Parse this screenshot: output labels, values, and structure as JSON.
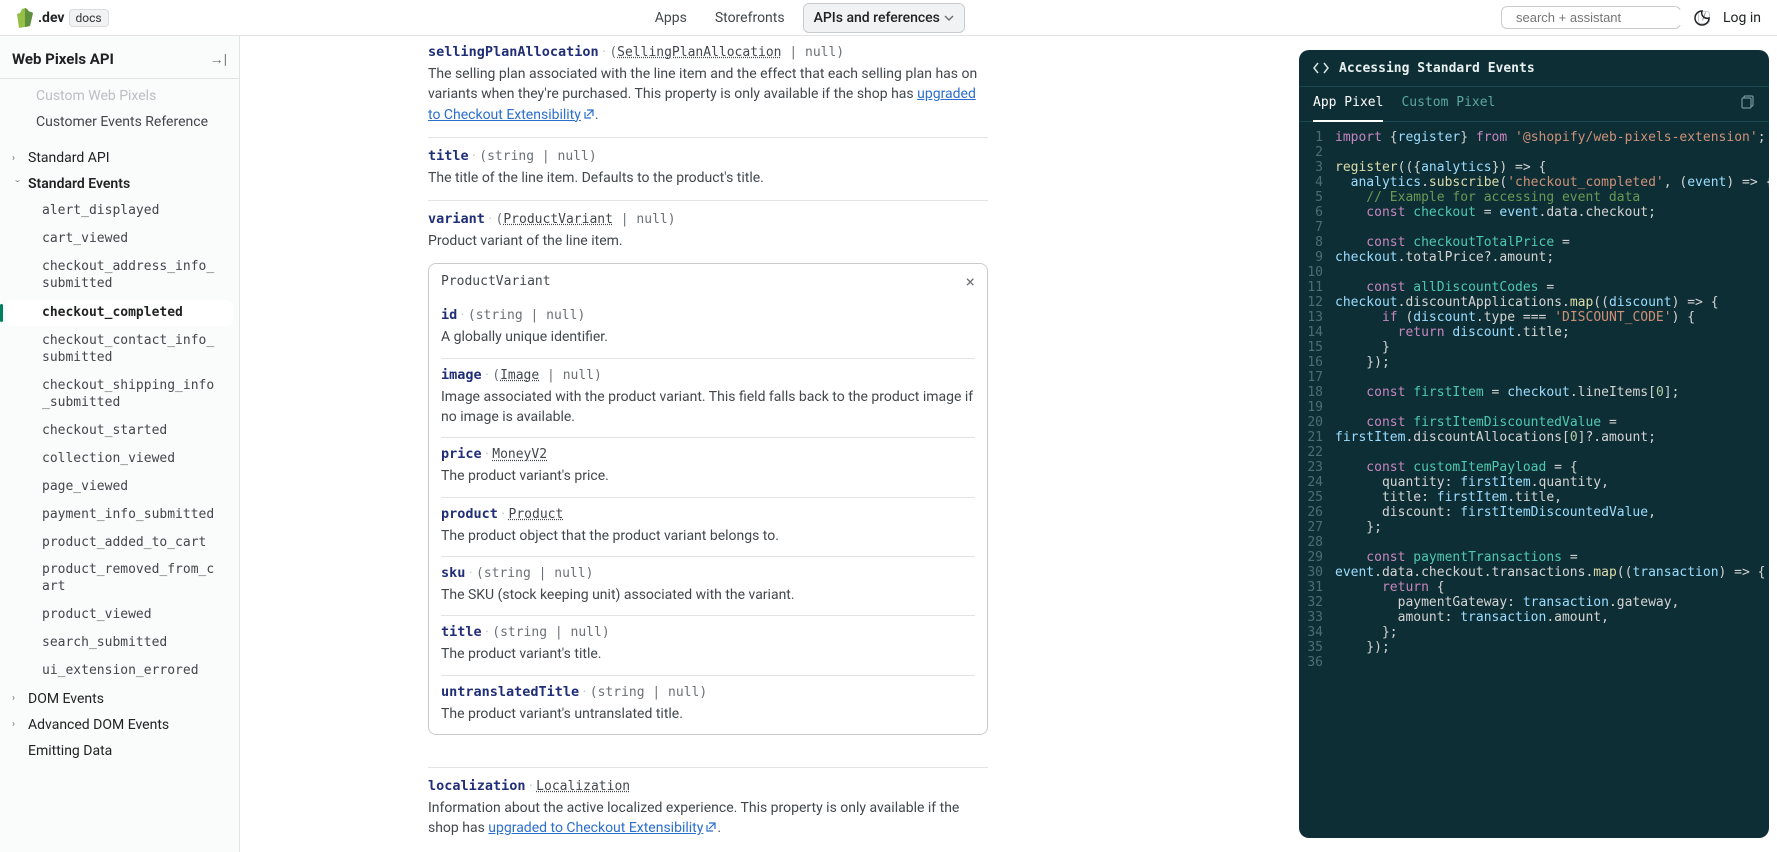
{
  "topbar": {
    "brand": ".dev",
    "docs_badge": "docs",
    "nav": [
      "Apps",
      "Storefronts",
      "APIs and references"
    ],
    "active_nav_index": 2,
    "search_placeholder": "search + assistant",
    "slash_hint": "/",
    "login": "Log in"
  },
  "sidebar": {
    "title": "Web Pixels API",
    "items_top": [
      "Custom Web Pixels",
      "Customer Events Reference"
    ],
    "standard_api": "Standard API",
    "standard_events": "Standard Events",
    "events": [
      "alert_displayed",
      "cart_viewed",
      "checkout_address_info_submitted",
      "checkout_completed",
      "checkout_contact_info_submitted",
      "checkout_shipping_info_submitted",
      "checkout_started",
      "collection_viewed",
      "page_viewed",
      "payment_info_submitted",
      "product_added_to_cart",
      "product_removed_from_cart",
      "product_viewed",
      "search_submitted",
      "ui_extension_errored"
    ],
    "active_event_index": 3,
    "dom_events": "DOM Events",
    "adv_dom_events": "Advanced DOM Events",
    "emitting_data": "Emitting Data"
  },
  "doc": {
    "props": [
      {
        "name": "sellingPlanAllocation",
        "meta_pre": "(",
        "meta_link": "SellingPlanAllocation",
        "meta_post": " | null)",
        "desc_pre": "The selling plan associated with the line item and the effect that each selling plan has on variants when they're purchased. This property is only available if the shop has ",
        "desc_link": "upgraded to Checkout Extensibility",
        "desc_post": ".",
        "external": true
      },
      {
        "name": "title",
        "meta": "(string | null)",
        "desc": "The title of the line item. Defaults to the product's title."
      },
      {
        "name": "variant",
        "meta_pre": "(",
        "meta_link": "ProductVariant",
        "meta_post": " | null)",
        "desc": "Product variant of the line item."
      }
    ],
    "nested": {
      "title": "ProductVariant",
      "props": [
        {
          "name": "id",
          "meta": "(string | null)",
          "desc": "A globally unique identifier."
        },
        {
          "name": "image",
          "meta_pre": "(",
          "meta_link": "Image",
          "meta_post": " | null)",
          "desc": "Image associated with the product variant. This field falls back to the product image if no image is available."
        },
        {
          "name": "price",
          "meta_link": "MoneyV2",
          "desc": "The product variant's price."
        },
        {
          "name": "product",
          "meta_link": "Product",
          "desc": "The product object that the product variant belongs to."
        },
        {
          "name": "sku",
          "meta": "(string | null)",
          "desc": "The SKU (stock keeping unit) associated with the variant."
        },
        {
          "name": "title",
          "meta": "(string | null)",
          "desc": "The product variant's title."
        },
        {
          "name": "untranslatedTitle",
          "meta": "(string | null)",
          "desc": "The product variant's untranslated title."
        }
      ]
    },
    "localization": {
      "name": "localization",
      "meta_link": "Localization",
      "desc_pre": "Information about the active localized experience. This property is only available if the shop has ",
      "desc_link": "upgraded to Checkout Extensibility",
      "desc_post": "."
    }
  },
  "code": {
    "title": "Accessing Standard Events",
    "tabs": [
      "App Pixel",
      "Custom Pixel"
    ],
    "active_tab": 0,
    "lines": [
      [
        {
          "t": "import ",
          "c": "c-kw"
        },
        {
          "t": "{",
          "c": "c-pn"
        },
        {
          "t": "register",
          "c": "c-var"
        },
        {
          "t": "}",
          "c": "c-pn"
        },
        {
          "t": " from ",
          "c": "c-kw"
        },
        {
          "t": "'@shopify/web-pixels-extension'",
          "c": "c-str"
        },
        {
          "t": ";",
          "c": "c-pn"
        }
      ],
      [],
      [
        {
          "t": "register",
          "c": "c-fn"
        },
        {
          "t": "(({",
          "c": "c-pn"
        },
        {
          "t": "analytics",
          "c": "c-var"
        },
        {
          "t": "}) => {",
          "c": "c-pn"
        }
      ],
      [
        {
          "t": "  analytics",
          "c": "c-var"
        },
        {
          "t": ".",
          "c": "c-pn"
        },
        {
          "t": "subscribe",
          "c": "c-fn"
        },
        {
          "t": "(",
          "c": "c-pn"
        },
        {
          "t": "'checkout_completed'",
          "c": "c-str"
        },
        {
          "t": ", (",
          "c": "c-pn"
        },
        {
          "t": "event",
          "c": "c-var"
        },
        {
          "t": ") => {",
          "c": "c-pn"
        }
      ],
      [
        {
          "t": "    // Example for accessing event data",
          "c": "c-cm"
        }
      ],
      [
        {
          "t": "    const ",
          "c": "c-kw"
        },
        {
          "t": "checkout",
          "c": "c-id"
        },
        {
          "t": " = ",
          "c": "c-op"
        },
        {
          "t": "event",
          "c": "c-var"
        },
        {
          "t": ".data.checkout;",
          "c": "c-pn"
        }
      ],
      [],
      [
        {
          "t": "    const ",
          "c": "c-kw"
        },
        {
          "t": "checkoutTotalPrice",
          "c": "c-id"
        },
        {
          "t": " = ",
          "c": "c-op"
        }
      ],
      [
        {
          "t": "checkout",
          "c": "c-var"
        },
        {
          "t": ".totalPrice?.amount;",
          "c": "c-pn"
        }
      ],
      [],
      [
        {
          "t": "    const ",
          "c": "c-kw"
        },
        {
          "t": "allDiscountCodes",
          "c": "c-id"
        },
        {
          "t": " = ",
          "c": "c-op"
        }
      ],
      [
        {
          "t": "checkout",
          "c": "c-var"
        },
        {
          "t": ".discountApplications.",
          "c": "c-pn"
        },
        {
          "t": "map",
          "c": "c-fn"
        },
        {
          "t": "((",
          "c": "c-pn"
        },
        {
          "t": "discount",
          "c": "c-var"
        },
        {
          "t": ") => {",
          "c": "c-pn"
        }
      ],
      [
        {
          "t": "      if ",
          "c": "c-kw"
        },
        {
          "t": "(",
          "c": "c-pn"
        },
        {
          "t": "discount",
          "c": "c-var"
        },
        {
          "t": ".type === ",
          "c": "c-pn"
        },
        {
          "t": "'DISCOUNT_CODE'",
          "c": "c-str"
        },
        {
          "t": ") {",
          "c": "c-pn"
        }
      ],
      [
        {
          "t": "        return ",
          "c": "c-kw"
        },
        {
          "t": "discount",
          "c": "c-var"
        },
        {
          "t": ".title;",
          "c": "c-pn"
        }
      ],
      [
        {
          "t": "      }",
          "c": "c-pn"
        }
      ],
      [
        {
          "t": "    });",
          "c": "c-pn"
        }
      ],
      [],
      [
        {
          "t": "    const ",
          "c": "c-kw"
        },
        {
          "t": "firstItem",
          "c": "c-id"
        },
        {
          "t": " = ",
          "c": "c-op"
        },
        {
          "t": "checkout",
          "c": "c-var"
        },
        {
          "t": ".lineItems[",
          "c": "c-pn"
        },
        {
          "t": "0",
          "c": "c-num"
        },
        {
          "t": "];",
          "c": "c-pn"
        }
      ],
      [],
      [
        {
          "t": "    const ",
          "c": "c-kw"
        },
        {
          "t": "firstItemDiscountedValue",
          "c": "c-id"
        },
        {
          "t": " = ",
          "c": "c-op"
        }
      ],
      [
        {
          "t": "firstItem",
          "c": "c-var"
        },
        {
          "t": ".discountAllocations[",
          "c": "c-pn"
        },
        {
          "t": "0",
          "c": "c-num"
        },
        {
          "t": "]?.amount;",
          "c": "c-pn"
        }
      ],
      [],
      [
        {
          "t": "    const ",
          "c": "c-kw"
        },
        {
          "t": "customItemPayload",
          "c": "c-id"
        },
        {
          "t": " = {",
          "c": "c-pn"
        }
      ],
      [
        {
          "t": "      quantity: ",
          "c": "c-pn"
        },
        {
          "t": "firstItem",
          "c": "c-var"
        },
        {
          "t": ".quantity,",
          "c": "c-pn"
        }
      ],
      [
        {
          "t": "      title: ",
          "c": "c-pn"
        },
        {
          "t": "firstItem",
          "c": "c-var"
        },
        {
          "t": ".title,",
          "c": "c-pn"
        }
      ],
      [
        {
          "t": "      discount: ",
          "c": "c-pn"
        },
        {
          "t": "firstItemDiscountedValue",
          "c": "c-var"
        },
        {
          "t": ",",
          "c": "c-pn"
        }
      ],
      [
        {
          "t": "    };",
          "c": "c-pn"
        }
      ],
      [],
      [
        {
          "t": "    const ",
          "c": "c-kw"
        },
        {
          "t": "paymentTransactions",
          "c": "c-id"
        },
        {
          "t": " = ",
          "c": "c-op"
        }
      ],
      [
        {
          "t": "event",
          "c": "c-var"
        },
        {
          "t": ".data.checkout.transactions.",
          "c": "c-pn"
        },
        {
          "t": "map",
          "c": "c-fn"
        },
        {
          "t": "((",
          "c": "c-pn"
        },
        {
          "t": "transaction",
          "c": "c-var"
        },
        {
          "t": ") => {",
          "c": "c-pn"
        }
      ],
      [
        {
          "t": "      return ",
          "c": "c-kw"
        },
        {
          "t": "{",
          "c": "c-pn"
        }
      ],
      [
        {
          "t": "        paymentGateway: ",
          "c": "c-pn"
        },
        {
          "t": "transaction",
          "c": "c-var"
        },
        {
          "t": ".gateway,",
          "c": "c-pn"
        }
      ],
      [
        {
          "t": "        amount: ",
          "c": "c-pn"
        },
        {
          "t": "transaction",
          "c": "c-var"
        },
        {
          "t": ".amount,",
          "c": "c-pn"
        }
      ],
      [
        {
          "t": "      };",
          "c": "c-pn"
        }
      ],
      [
        {
          "t": "    });",
          "c": "c-pn"
        }
      ],
      []
    ]
  }
}
